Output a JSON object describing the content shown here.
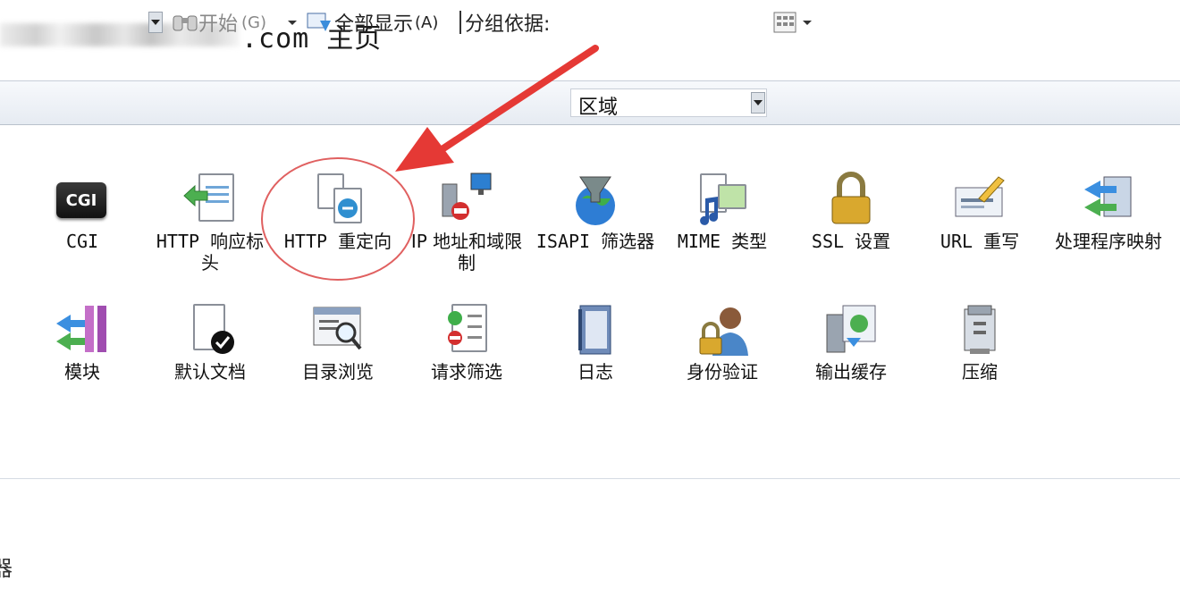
{
  "title": {
    "suffix": ".com 主页"
  },
  "toolbar": {
    "start_label": "开始",
    "start_shortcut": "(G)",
    "show_all_label": "全部显示",
    "show_all_shortcut": "(A)",
    "group_by_label": "分组依据:",
    "group_by_value": "区域"
  },
  "features": [
    {
      "label": "CGI",
      "icon": "cgi-icon"
    },
    {
      "label": "HTTP 响应标头",
      "icon": "http-response-headers-icon"
    },
    {
      "label": "HTTP 重定向",
      "icon": "http-redirect-icon"
    },
    {
      "label": "IP 地址和域限制",
      "icon": "ip-domain-restrictions-icon"
    },
    {
      "label": "ISAPI 筛选器",
      "icon": "isapi-filter-icon"
    },
    {
      "label": "MIME 类型",
      "icon": "mime-types-icon"
    },
    {
      "label": "SSL 设置",
      "icon": "ssl-lock-icon"
    },
    {
      "label": "URL 重写",
      "icon": "url-rewrite-icon"
    },
    {
      "label": "处理程序映射",
      "icon": "handler-mappings-icon"
    },
    {
      "label": "模块",
      "icon": "modules-icon"
    },
    {
      "label": "默认文档",
      "icon": "default-document-icon"
    },
    {
      "label": "目录浏览",
      "icon": "directory-browsing-icon"
    },
    {
      "label": "请求筛选",
      "icon": "request-filtering-icon"
    },
    {
      "label": "日志",
      "icon": "logging-icon"
    },
    {
      "label": "身份验证",
      "icon": "authentication-icon"
    },
    {
      "label": "输出缓存",
      "icon": "output-caching-icon"
    },
    {
      "label": "压缩",
      "icon": "compression-icon"
    }
  ],
  "colors": {
    "annotation": "#e03a3a",
    "toolbar_bg": "#e9edf3"
  },
  "footer": {
    "partial_char": "器"
  }
}
